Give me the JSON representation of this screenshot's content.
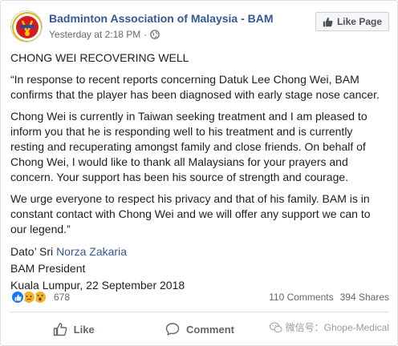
{
  "header": {
    "page_name": "Badminton Association of Malaysia - BAM",
    "timestamp": "Yesterday at 2:18 PM",
    "dot": "·",
    "like_page_label": "Like Page"
  },
  "post": {
    "title": "CHONG WEI RECOVERING WELL",
    "paragraph1": "“In response to recent reports concerning Datuk Lee Chong Wei, BAM confirms that the player has been diagnosed with early stage nose cancer.",
    "paragraph2": "Chong Wei is currently in Taiwan seeking treatment and I am pleased to inform you that he is responding well to his treatment and is currently resting and recuperating amongst family and close friends. On behalf of Chong Wei, I would like to thank all Malaysians for your prayers and concern. Your support has been his source of strength and courage.",
    "paragraph3": "We urge everyone to respect his privacy and that of his family. BAM is in constant contact with Chong Wei and we will offer any support we can to our legend.”",
    "sig_prefix": "Dato’ Sri ",
    "sig_name": "Norza Zakaria",
    "sig_role": "BAM President",
    "sig_place_date": "Kuala Lumpur, 22 September 2018"
  },
  "stats": {
    "reaction_count": "678",
    "comments": "110 Comments",
    "shares": "394 Shares",
    "reaction_icons": [
      "like-icon",
      "sad-icon",
      "wow-icon"
    ]
  },
  "actions": {
    "like": "Like",
    "comment": "Comment"
  },
  "watermark": {
    "text": "微信号：Ghope-Medical"
  },
  "colors": {
    "link": "#365899",
    "text": "#1c1e21",
    "muted": "#616770",
    "like_blue": "#1877f2",
    "reaction_yellow": "#f7b125"
  }
}
